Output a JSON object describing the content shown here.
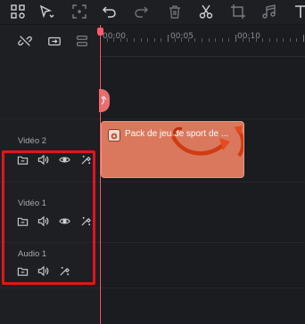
{
  "toolbar": {
    "icons": [
      "layout-grid-icon",
      "select-cursor-icon",
      "crop-fit-icon",
      "undo-icon",
      "redo-icon",
      "delete-icon",
      "cut-icon",
      "crop-icon",
      "audio-icon",
      "text-icon"
    ]
  },
  "subbar": {
    "icons": [
      "unlink-icon",
      "link-clip-icon",
      "track-manager-icon"
    ]
  },
  "ruler": {
    "labels": [
      "00:00",
      "00:05",
      "00:10"
    ]
  },
  "tracks": [
    {
      "name": "Vidéo 2",
      "controls": [
        "folder-icon",
        "volume-icon",
        "eye-icon",
        "magic-wand-icon"
      ]
    },
    {
      "name": "Vidéo 1",
      "controls": [
        "folder-icon",
        "volume-icon",
        "eye-icon",
        "magic-wand-icon"
      ]
    },
    {
      "name": "Audio 1",
      "controls": [
        "folder-icon",
        "volume-icon",
        "magic-wand-icon"
      ]
    }
  ],
  "clip": {
    "title": "Pack de jeu de sport de ...",
    "color": "#d9785d"
  },
  "colors": {
    "playhead": "#ff5b6e",
    "highlight": "#e0161c",
    "accent": "#d9785d"
  }
}
